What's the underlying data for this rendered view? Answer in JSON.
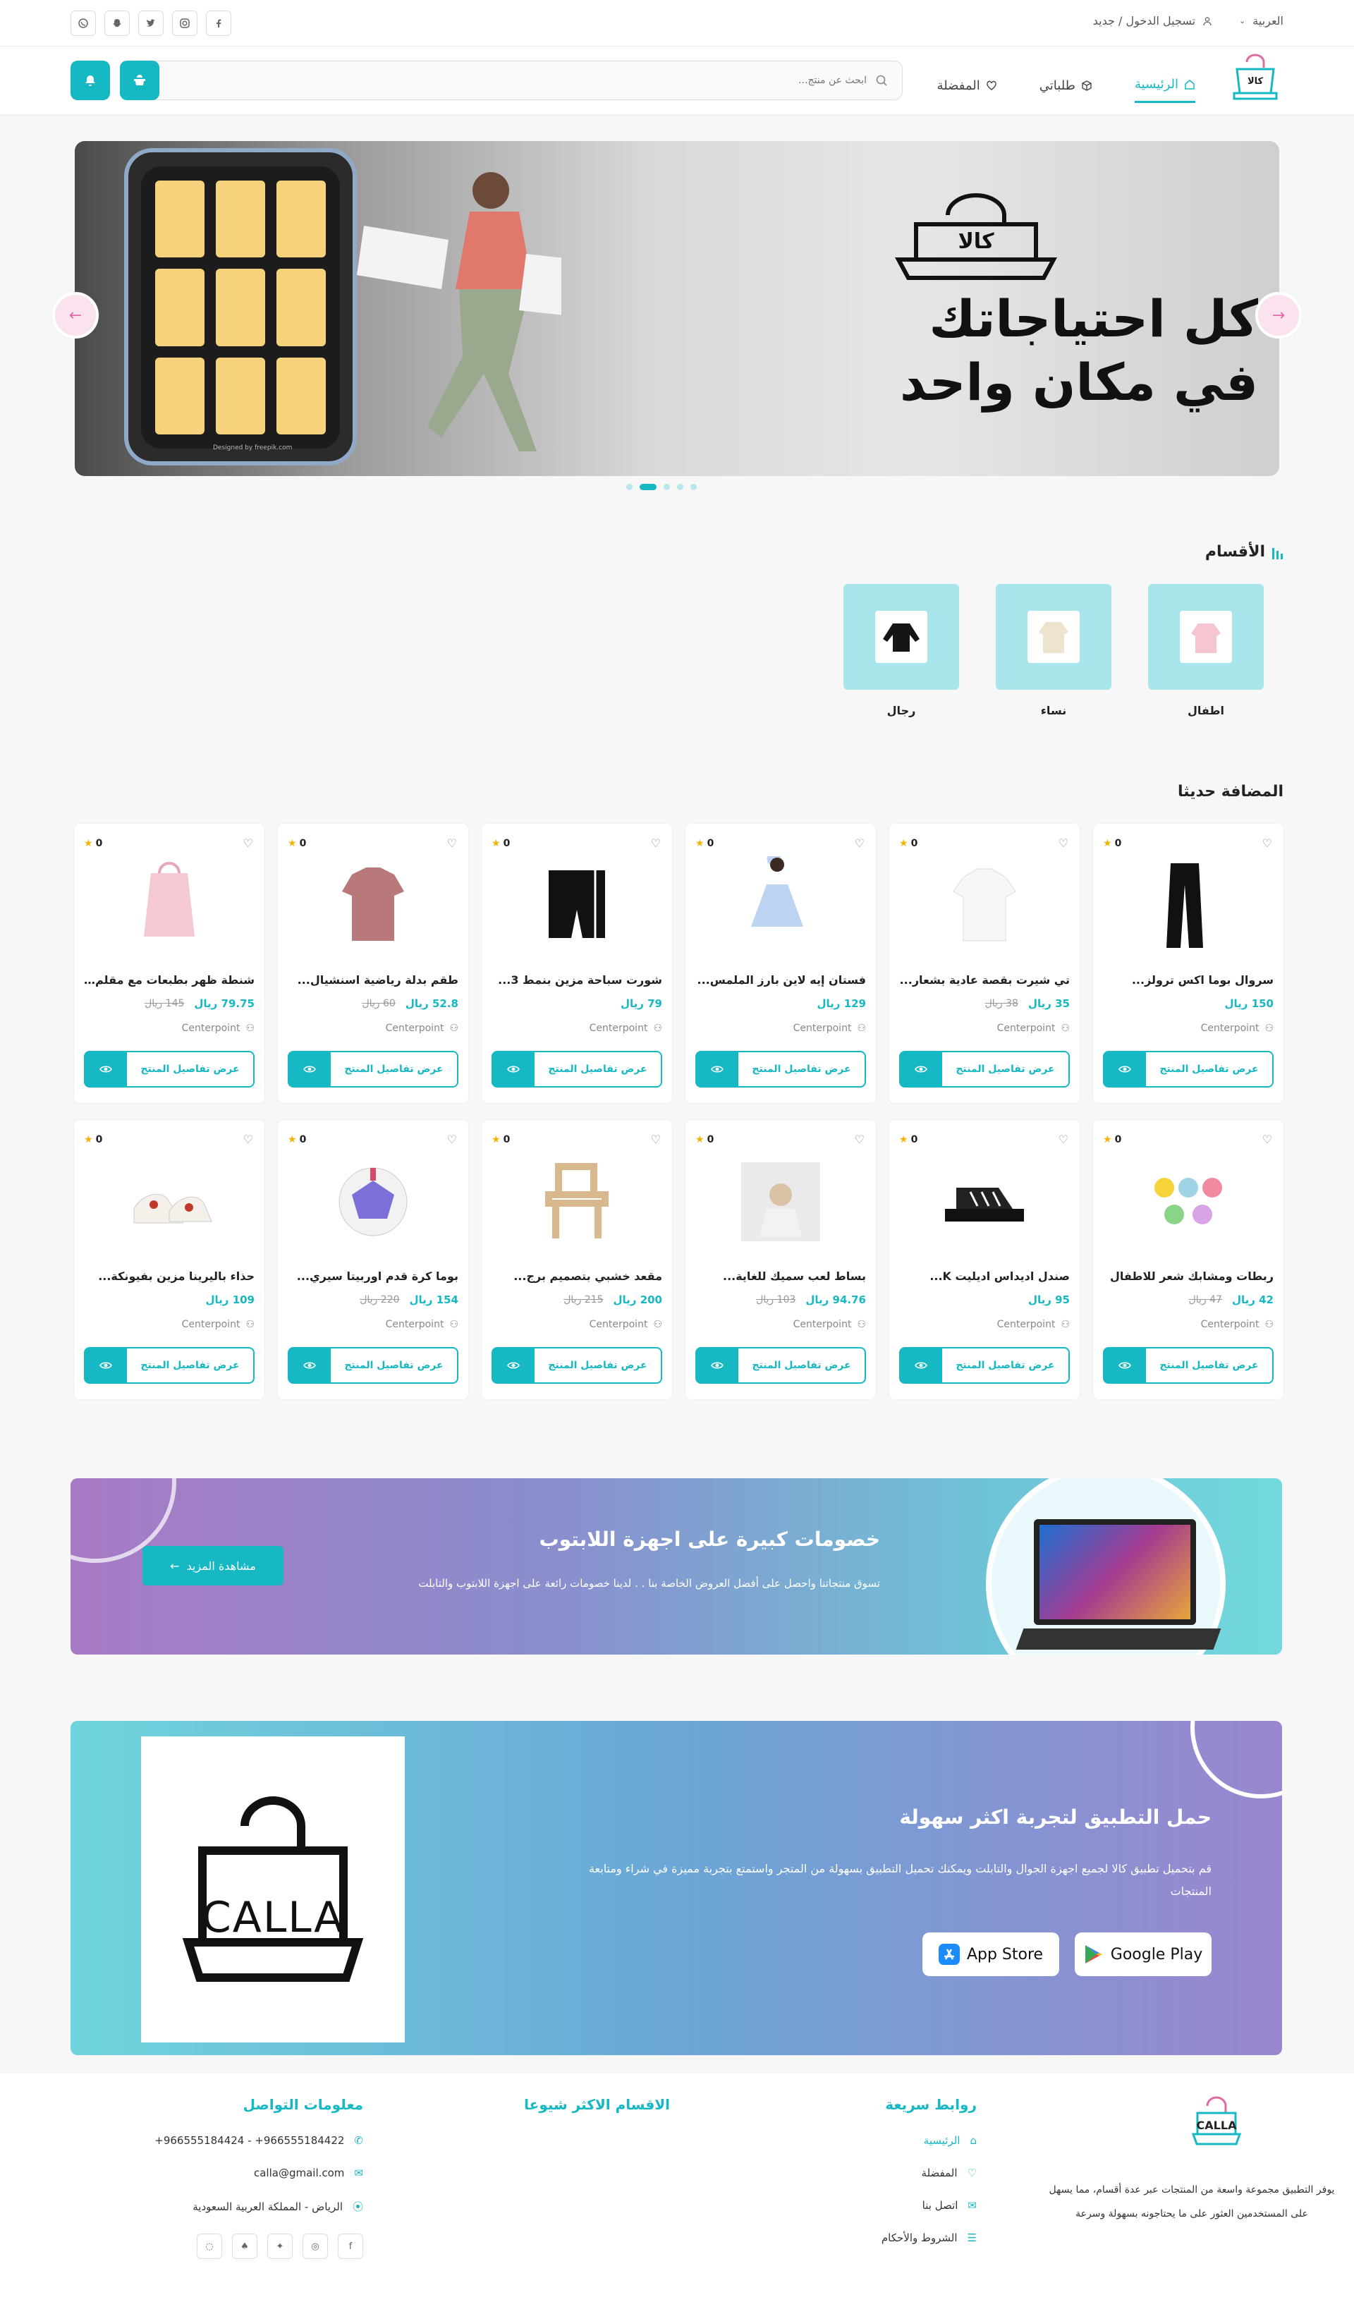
{
  "topbar": {
    "language": "العربية",
    "login": "تسجيل الدخول / جديد",
    "social": [
      "facebook-icon",
      "instagram-icon",
      "twitter-icon",
      "snapchat-icon",
      "whatsapp-icon"
    ]
  },
  "nav": {
    "brand": "كالا",
    "links": [
      "الرئيسية",
      "طلباتي",
      "المفضلة"
    ],
    "search_placeholder": "ابحث عن منتج..."
  },
  "hero": {
    "logo_text": "كالا",
    "headline_1": "كل احتياجاتك",
    "headline_2": "في مكان واحد",
    "credit": "Designed by freepik.com"
  },
  "categories": {
    "title": "الأقسام",
    "items": [
      "اطفال",
      "نساء",
      "رجال"
    ]
  },
  "recent": {
    "title": "المضافة حديثا",
    "view_label": "عرض تفاصيل المنتج",
    "currency": "ريال",
    "products": [
      {
        "name": "سروال بوما اكس ترولز...",
        "price": "150",
        "old": "",
        "store": "Centerpoint",
        "rating": "0"
      },
      {
        "name": "تي شيرت بقصة عادية بشعار...",
        "price": "35",
        "old": "38",
        "store": "Centerpoint",
        "rating": "0"
      },
      {
        "name": "فستان إيه لاين بارز الملمس...",
        "price": "129",
        "old": "",
        "store": "Centerpoint",
        "rating": "0"
      },
      {
        "name": "شورت سباحة مزين بنمط 3...",
        "price": "79",
        "old": "",
        "store": "Centerpoint",
        "rating": "0"
      },
      {
        "name": "طقم بدلة رياضية اسنشيال...",
        "price": "52.8",
        "old": "60",
        "store": "Centerpoint",
        "rating": "0"
      },
      {
        "name": "شنطة ظهر بطبعات مع مقلم...",
        "price": "79.75",
        "old": "145",
        "store": "Centerpoint",
        "rating": "0"
      },
      {
        "name": "ربطات ومشابك شعر للاطفال",
        "price": "42",
        "old": "47",
        "store": "Centerpoint",
        "rating": "0"
      },
      {
        "name": "صندل اديداس اديليت K...",
        "price": "95",
        "old": "",
        "store": "Centerpoint",
        "rating": "0"
      },
      {
        "name": "بساط لعب سميك للغاية...",
        "price": "94.76",
        "old": "103",
        "store": "Centerpoint",
        "rating": "0"
      },
      {
        "name": "مقعد خشبي بتصميم برج...",
        "price": "200",
        "old": "215",
        "store": "Centerpoint",
        "rating": "0"
      },
      {
        "name": "بوما كرة قدم اوربيتا سيري...",
        "price": "154",
        "old": "220",
        "store": "Centerpoint",
        "rating": "0"
      },
      {
        "name": "حذاء باليرينا مزين بفيونكة...",
        "price": "109",
        "old": "",
        "store": "Centerpoint",
        "rating": "0"
      }
    ]
  },
  "promo": {
    "title": "خصومات كبيرة على اجهزة اللابتوب",
    "text": "تسوق منتجاتنا واحصل على أفضل العروض الخاصة بنا . . لدينا خصومات رائعة على اجهزة اللابتوب والتابلت",
    "button": "مشاهدة المزيد"
  },
  "app": {
    "title": "حمل التطبيق لتجربة اكثر سهولة",
    "text": "قم بتحميل تطبيق كالا لجميع اجهزة الجوال والتابلت ويمكنك تحميل التطبيق بسهولة من المتجر واستمتع بتجربة مميزة في شراء ومتابعة المنتجات",
    "logo_text": "CALLA",
    "google": "Google Play",
    "apple": "App Store"
  },
  "footer": {
    "brand": "CALLA",
    "about": "يوفر التطبيق مجموعة واسعة من المنتجات عبر عدة أقسام، مما يسهل على المستخدمين العثور على ما يحتاجونه بسهولة وسرعة",
    "quick_title": "روابط سريعة",
    "quick": [
      "الرئيسية",
      "المفضلة",
      "اتصل بنا",
      "الشروط والأحكام"
    ],
    "popular_title": "الاقسام الاكثر شيوعا",
    "contact_title": "معلومات التواصل",
    "phones": "966555184422+ - 966555184424+",
    "email": "calla@gmail.com",
    "address": "الرياض - المملكة العربية السعودية"
  },
  "colors": {
    "accent": "#16b8c3",
    "category_bg": "#a9e6ec",
    "star": "#f5b301"
  }
}
